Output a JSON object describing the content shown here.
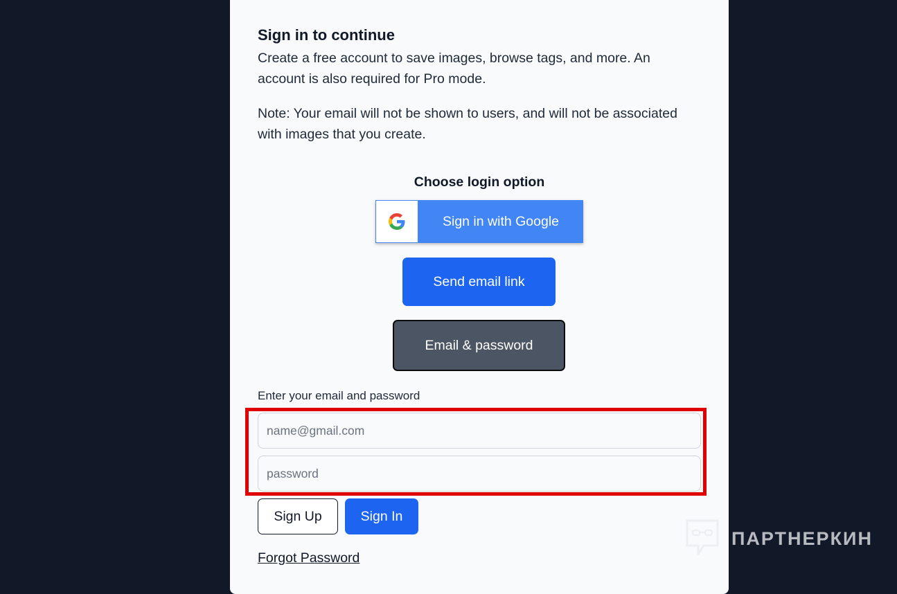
{
  "modal": {
    "title": "Sign in to continue",
    "description_1": "Create a free account to save images, browse tags, and more. An account is also required for Pro mode.",
    "description_2": "Note: Your email will not be shown to users, and will not be associated with images that you create.",
    "choose_label": "Choose login option",
    "google_button_label": "Sign in with Google",
    "email_link_button_label": "Send email link",
    "email_password_button_label": "Email & password",
    "form_label": "Enter your email and password",
    "email_placeholder": "name@gmail.com",
    "password_placeholder": "password",
    "sign_up_label": "Sign Up",
    "sign_in_label": "Sign In",
    "forgot_password_label": "Forgot Password"
  },
  "watermark": {
    "text": "ПАРТНЕРКИН"
  },
  "colors": {
    "backdrop": "#111827",
    "modal_bg": "#f9fafb",
    "primary_blue": "#1d65f0",
    "google_blue": "#4285f4",
    "dark_button": "#4b5563",
    "highlight_red": "#e00000"
  },
  "icons": {
    "google": "google-g-icon",
    "watermark": "chat-bubble-icon"
  }
}
